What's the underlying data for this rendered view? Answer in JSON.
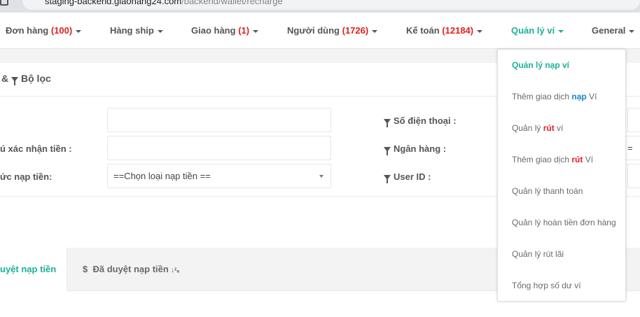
{
  "browser": {
    "url_main": "staging-backend.giaohang24.com",
    "url_path": "/backend/wallet/recharge"
  },
  "navbar": {
    "items": [
      {
        "label": "Đơn hàng",
        "count": "(100)"
      },
      {
        "label": "Hàng ship",
        "count": ""
      },
      {
        "label": "Giao hàng",
        "count": "(1)"
      },
      {
        "label": "Người dùng",
        "count": "(1726)"
      },
      {
        "label": "Kế toán",
        "count": "(12184)"
      },
      {
        "label": "Quản lý ví",
        "count": ""
      },
      {
        "label": "General",
        "count": ""
      }
    ]
  },
  "panel": {
    "title": "& ",
    "filter_title": "Bộ lọc",
    "label_confirm": "ú xác nhận tiền :",
    "label_method": "ức nạp tiền:",
    "select_method_value": "==Chọn loại nạp tiền ==",
    "label_phone": "Số điện thoại :",
    "label_bank": "Ngân hàng :",
    "label_user": "User ID :",
    "partial_select_text": "="
  },
  "tabs": {
    "active_label": "uyệt nạp tiền",
    "other_label": "Đã duyệt nạp tiền",
    "dollar_icon": "$",
    "sort_icon_glyph": "↓ᶻₐ"
  },
  "dropdown": {
    "items": [
      {
        "pre": "Quản lý nạp ví",
        "hl": "",
        "post": "",
        "hl_color": ""
      },
      {
        "pre": "Thêm giao dịch ",
        "hl": "nạp",
        "post": " Ví",
        "hl_color": "blue"
      },
      {
        "pre": "Quản lý ",
        "hl": "rút",
        "post": " ví",
        "hl_color": "red"
      },
      {
        "pre": "Thêm giao dịch ",
        "hl": "rút",
        "post": " Ví",
        "hl_color": "red"
      },
      {
        "pre": "Quản lý thanh toán",
        "hl": "",
        "post": "",
        "hl_color": ""
      },
      {
        "pre": "Quản lý hoàn tiền đơn hàng",
        "hl": "",
        "post": "",
        "hl_color": ""
      },
      {
        "pre": "Quản lý rút lãi",
        "hl": "",
        "post": "",
        "hl_color": ""
      },
      {
        "pre": "Tổng hợp số dư ví",
        "hl": "",
        "post": "",
        "hl_color": ""
      }
    ]
  }
}
